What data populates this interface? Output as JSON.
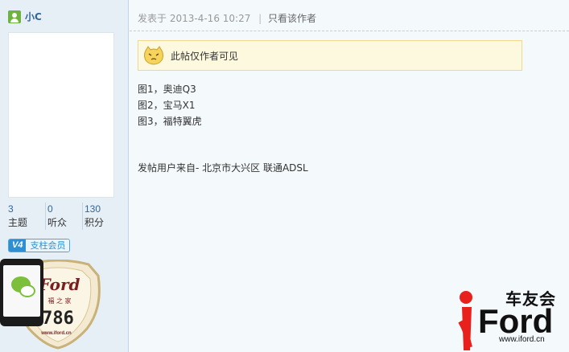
{
  "author": {
    "username": "小C",
    "stats": [
      {
        "value": "3",
        "label": "主题"
      },
      {
        "value": "0",
        "label": "听众"
      },
      {
        "value": "130",
        "label": "积分"
      }
    ],
    "badge": {
      "level": "V4",
      "label": "支柱会员"
    },
    "medal": {
      "text": "Ford",
      "subtext": "福 之 家",
      "number": "786",
      "url": "www.iford.cn"
    }
  },
  "post": {
    "meta_prefix": "发表于",
    "date": "2013-4-16 10:27",
    "author_only_link": "只看该作者",
    "notice": "此帖仅作者可见",
    "lines": [
      "图1，奥迪Q3",
      "图2，宝马X1",
      "图3，福特翼虎"
    ],
    "source": "发帖用户来自- 北京市大兴区 联通ADSL"
  },
  "logo": {
    "cn": "车友会",
    "en": "Ford",
    "url": "www.iford.cn"
  },
  "colors": {
    "accent": "#336699",
    "notice_bg": "#fdf9de",
    "logo_red": "#e8211c",
    "logo_black": "#111111"
  }
}
